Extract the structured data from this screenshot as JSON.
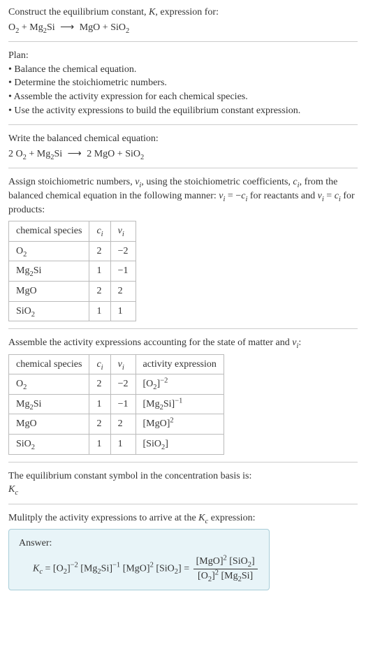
{
  "intro": {
    "line1": "Construct the equilibrium constant, ",
    "Ksym": "K",
    "line1b": ", expression for:",
    "eq_lhs1": "O",
    "eq_lhs1_sub": "2",
    "plus1": " + Mg",
    "eq_lhs2_sub": "2",
    "eq_lhs2b": "Si ",
    "arrow": "⟶",
    "eq_rhs1": " MgO + SiO",
    "eq_rhs2_sub": "2"
  },
  "plan": {
    "title": "Plan:",
    "b1": "• Balance the chemical equation.",
    "b2": "• Determine the stoichiometric numbers.",
    "b3": "• Assemble the activity expression for each chemical species.",
    "b4": "• Use the activity expressions to build the equilibrium constant expression."
  },
  "balanced": {
    "title": "Write the balanced chemical equation:",
    "l1": "2 O",
    "s1": "2",
    "l2": " + Mg",
    "s2": "2",
    "l3": "Si ",
    "arrow": "⟶",
    "l4": " 2 MgO + SiO",
    "s3": "2"
  },
  "assign": {
    "p1": "Assign stoichiometric numbers, ",
    "nu_i": "ν",
    "sub_i": "i",
    "p2": ", using the stoichiometric coefficients, ",
    "c_i": "c",
    "p3": ", from the balanced chemical equation in the following manner: ",
    "eq1a": "ν",
    "eq1b": " = −",
    "eq1c": "c",
    "p4": " for reactants and ",
    "eq2a": "ν",
    "eq2b": " = ",
    "eq2c": "c",
    "p5": " for products:"
  },
  "table1": {
    "h1": "chemical species",
    "h2": "c",
    "h2sub": "i",
    "h3": "ν",
    "h3sub": "i",
    "rows": [
      {
        "sp_a": "O",
        "sp_sub": "2",
        "sp_b": "",
        "c": "2",
        "nu": "−2"
      },
      {
        "sp_a": "Mg",
        "sp_sub": "2",
        "sp_b": "Si",
        "c": "1",
        "nu": "−1"
      },
      {
        "sp_a": "MgO",
        "sp_sub": "",
        "sp_b": "",
        "c": "2",
        "nu": "2"
      },
      {
        "sp_a": "SiO",
        "sp_sub": "2",
        "sp_b": "",
        "c": "1",
        "nu": "1"
      }
    ]
  },
  "assemble": {
    "p1": "Assemble the activity expressions accounting for the state of matter and ",
    "nu": "ν",
    "sub_i": "i",
    "colon": ":"
  },
  "table2": {
    "h1": "chemical species",
    "h2": "c",
    "h2sub": "i",
    "h3": "ν",
    "h3sub": "i",
    "h4": "activity expression",
    "rows": [
      {
        "sp_a": "O",
        "sp_sub": "2",
        "sp_b": "",
        "c": "2",
        "nu": "−2",
        "act_a": "[O",
        "act_sub": "2",
        "act_b": "]",
        "act_sup": "−2"
      },
      {
        "sp_a": "Mg",
        "sp_sub": "2",
        "sp_b": "Si",
        "c": "1",
        "nu": "−1",
        "act_a": "[Mg",
        "act_sub": "2",
        "act_b": "Si]",
        "act_sup": "−1"
      },
      {
        "sp_a": "MgO",
        "sp_sub": "",
        "sp_b": "",
        "c": "2",
        "nu": "2",
        "act_a": "[MgO]",
        "act_sub": "",
        "act_b": "",
        "act_sup": "2"
      },
      {
        "sp_a": "SiO",
        "sp_sub": "2",
        "sp_b": "",
        "c": "1",
        "nu": "1",
        "act_a": "[SiO",
        "act_sub": "2",
        "act_b": "]",
        "act_sup": ""
      }
    ]
  },
  "kc_symbol": {
    "p1": "The equilibrium constant symbol in the concentration basis is:",
    "K": "K",
    "sub": "c"
  },
  "multiply": {
    "p1": "Mulitply the activity expressions to arrive at the ",
    "K": "K",
    "sub": "c",
    "p2": " expression:"
  },
  "answer": {
    "label": "Answer:",
    "K": "K",
    "Ksub": "c",
    "eq": " = ",
    "t1": "[O",
    "t1sub": "2",
    "t1b": "]",
    "t1sup": "−2",
    "t2": " [Mg",
    "t2sub": "2",
    "t2b": "Si]",
    "t2sup": "−1",
    "t3": " [MgO]",
    "t3sup": "2",
    "t4": " [SiO",
    "t4sub": "2",
    "t4b": "]",
    "eq2": " = ",
    "num1": "[MgO]",
    "num1sup": "2",
    "num2": " [SiO",
    "num2sub": "2",
    "num2b": "]",
    "den1": "[O",
    "den1sub": "2",
    "den1b": "]",
    "den1sup": "2",
    "den2": " [Mg",
    "den2sub": "2",
    "den2b": "Si]"
  }
}
